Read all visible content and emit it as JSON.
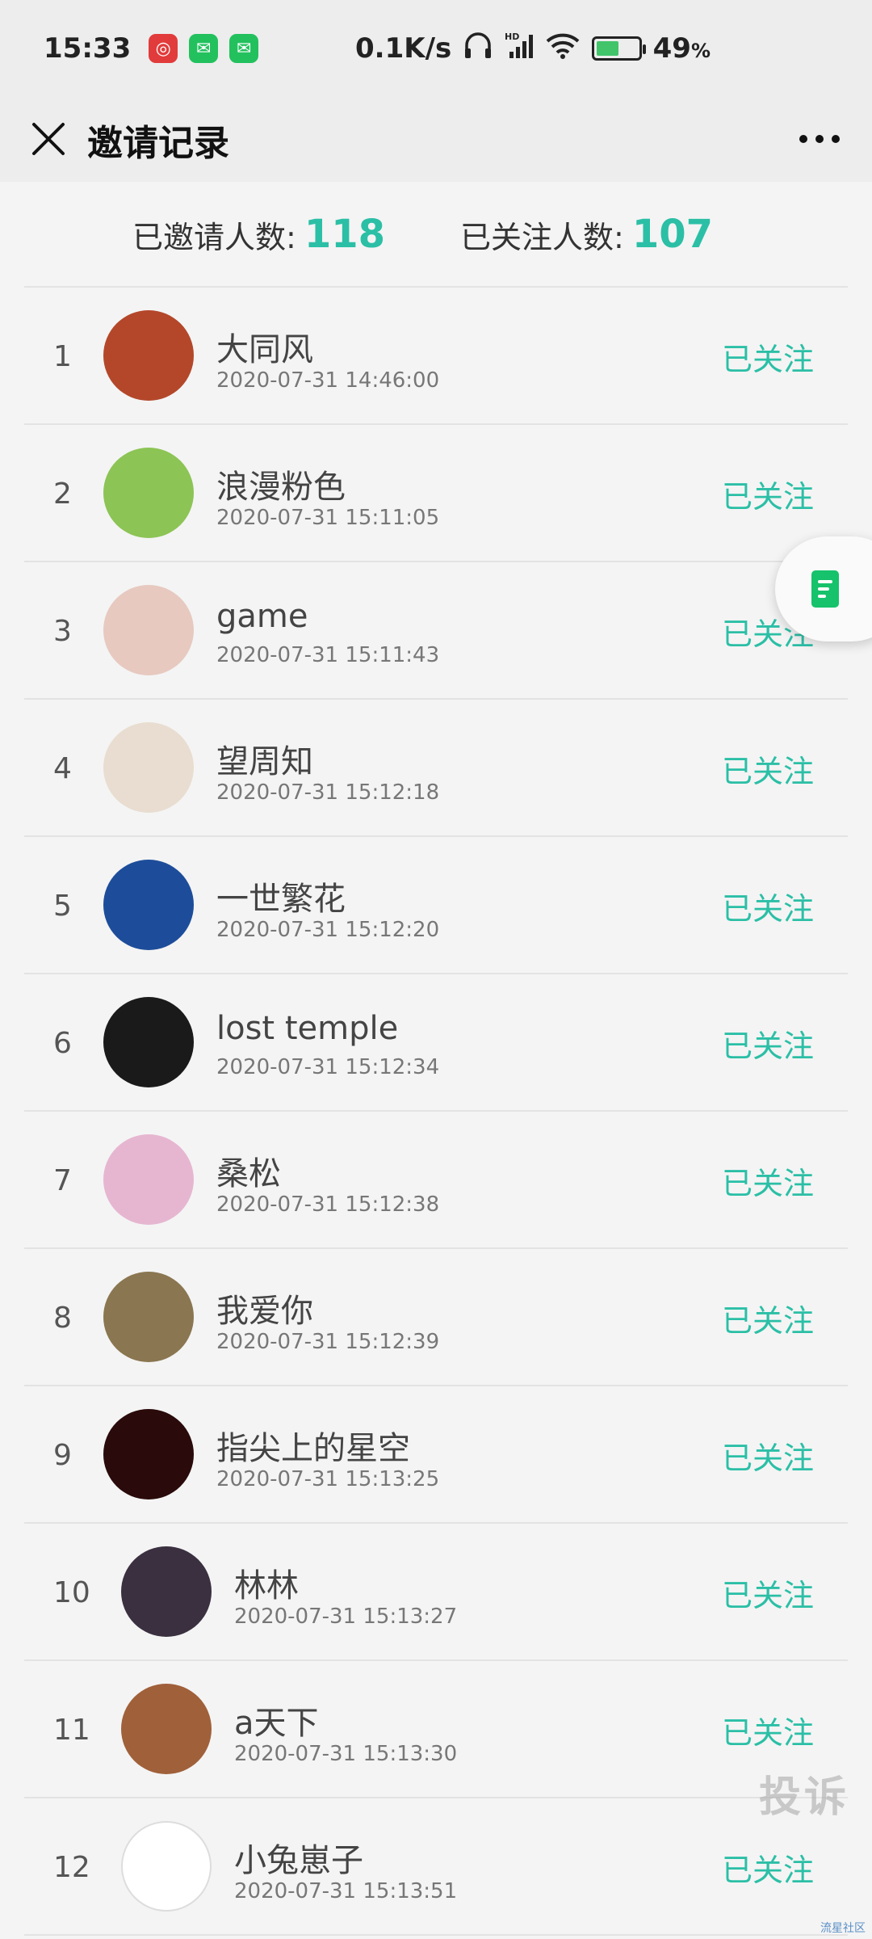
{
  "status_bar": {
    "time": "15:33",
    "speed": "0.1K/s",
    "battery_percent": "49",
    "battery_unit": "%",
    "battery_level": 0.49,
    "icons": [
      "netease-music-icon",
      "wechat-icon",
      "wechat-icon",
      "headphone-icon",
      "hd-signal-icon",
      "wifi-icon",
      "battery-charging-icon"
    ]
  },
  "header": {
    "title": "邀请记录",
    "close_icon": "close-icon",
    "more_icon": "more-dots-icon"
  },
  "stats": {
    "invited_label": "已邀请人数:",
    "invited_count": "118",
    "followed_label": "已关注人数:",
    "followed_count": "107"
  },
  "accent_color": "#2bbfa6",
  "invites": [
    {
      "index": "1",
      "name": "大同风",
      "time": "2020-07-31 14:46:00",
      "status": "已关注",
      "avatar_color": "#b4472a"
    },
    {
      "index": "2",
      "name": "浪漫粉色",
      "time": "2020-07-31 15:11:05",
      "status": "已关注",
      "avatar_color": "#8cc455"
    },
    {
      "index": "3",
      "name": "game",
      "time": "2020-07-31 15:11:43",
      "status": "已关注",
      "avatar_color": "#e7c9c0"
    },
    {
      "index": "4",
      "name": "望周知",
      "time": "2020-07-31 15:12:18",
      "status": "已关注",
      "avatar_color": "#e8ddd0"
    },
    {
      "index": "5",
      "name": "一世繁花",
      "time": "2020-07-31 15:12:20",
      "status": "已关注",
      "avatar_color": "#1d4d9a"
    },
    {
      "index": "6",
      "name": "lost temple",
      "time": "2020-07-31 15:12:34",
      "status": "已关注",
      "avatar_color": "#1a1a1a"
    },
    {
      "index": "7",
      "name": "桑松",
      "time": "2020-07-31 15:12:38",
      "status": "已关注",
      "avatar_color": "#e6b6d0"
    },
    {
      "index": "8",
      "name": "我爱你",
      "time": "2020-07-31 15:12:39",
      "status": "已关注",
      "avatar_color": "#8a7650"
    },
    {
      "index": "9",
      "name": "指尖上的星空",
      "time": "2020-07-31 15:13:25",
      "status": "已关注",
      "avatar_color": "#2a0a0a"
    },
    {
      "index": "10",
      "name": "林林",
      "time": "2020-07-31 15:13:27",
      "status": "已关注",
      "avatar_color": "#3a3040"
    },
    {
      "index": "11",
      "name": "a天下",
      "time": "2020-07-31 15:13:30",
      "status": "已关注",
      "avatar_color": "#a0603a"
    },
    {
      "index": "12",
      "name": "小兔崽子",
      "time": "2020-07-31 15:13:51",
      "status": "已关注",
      "avatar_color": "#ffffff"
    }
  ],
  "watermark": "投诉",
  "corner_watermark": "流星社区"
}
